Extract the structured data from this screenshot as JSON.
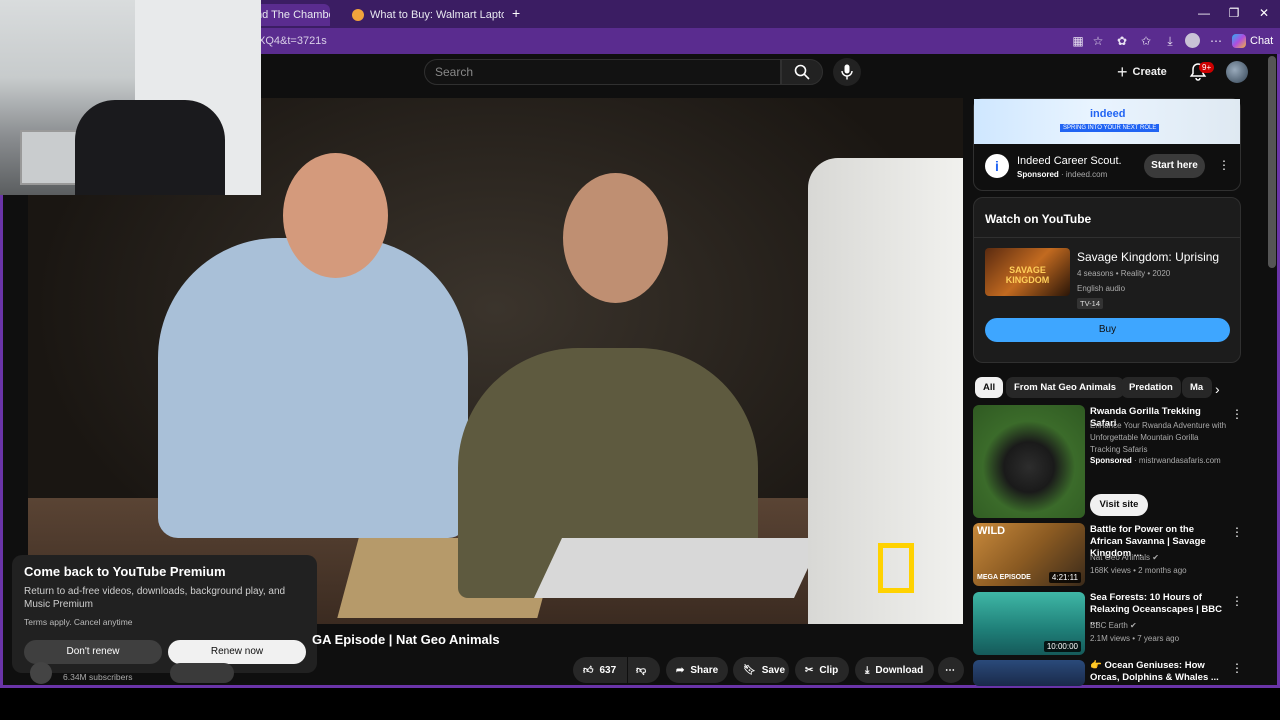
{
  "browser": {
    "tabs": [
      {
        "label": "nd The Chamber Of"
      },
      {
        "label": "What to Buy: Walmart Laptops for"
      }
    ],
    "new_tab": "+",
    "url": "XQ4&t=3721s",
    "chat_label": "Chat",
    "window_controls": {
      "minimize": "—",
      "restore": "❐",
      "close": "✕"
    }
  },
  "header": {
    "search_placeholder": "Search",
    "create_label": "Create",
    "notification_count": "9+"
  },
  "premium": {
    "title": "Come back to YouTube Premium",
    "description": "Return to ad-free videos, downloads, background play, and Music Premium",
    "terms": "Terms apply. Cancel anytime",
    "dont_renew": "Don't renew",
    "renew_now": "Renew now"
  },
  "video": {
    "title_visible": "GA Episode | Nat Geo Animals",
    "subscribers": "6.34M subscribers",
    "like_count": "637",
    "actions": {
      "share": "Share",
      "save": "Save",
      "clip": "Clip",
      "download": "Download"
    }
  },
  "ad": {
    "brand": "indeed",
    "tagline": "SPRING INTO YOUR NEXT ROLE",
    "name": "Indeed Career Scout.",
    "sponsored": "Sponsored",
    "domain": " · indeed.com",
    "cta": "Start here"
  },
  "watch": {
    "heading": "Watch on YouTube",
    "thumb_text": "SAVAGE KINGDOM",
    "title": "Savage Kingdom: Uprising",
    "meta": "4 seasons • Reality • 2020",
    "audio": "English audio",
    "rating": "TV-14",
    "buy": "Buy"
  },
  "chips": [
    "All",
    "From Nat Geo Animals",
    "Predation",
    "Ma"
  ],
  "related": [
    {
      "title": "Rwanda Gorilla Trekking Safari",
      "desc": "Enhance Your Rwanda Adventure with Unforgettable Mountain Gorilla Tracking Safaris",
      "sponsored": "Sponsored",
      "domain": " · mistrwandasafaris.com",
      "cta": "Visit site"
    },
    {
      "title": "Battle for Power on the African Savanna | Savage Kingdom ...",
      "channel": "Nat Geo Animals",
      "meta": "168K views • 2 months ago",
      "duration": "4:21:11",
      "badge": "WILD",
      "sub": "MEGA EPISODE"
    },
    {
      "title": "Sea Forests: 10 Hours of Relaxing Oceanscapes | BBC ...",
      "channel": "BBC Earth",
      "meta": "2.1M views • 7 years ago",
      "duration": "10:00:00"
    },
    {
      "title": "👉 Ocean Geniuses: How Orcas, Dolphins & Whales ..."
    }
  ],
  "colors": {
    "accent_purple": "#5a2c8f",
    "yt_red": "#cc0000",
    "buy_blue": "#3ea6ff",
    "natgeo_yellow": "#ffd200"
  }
}
